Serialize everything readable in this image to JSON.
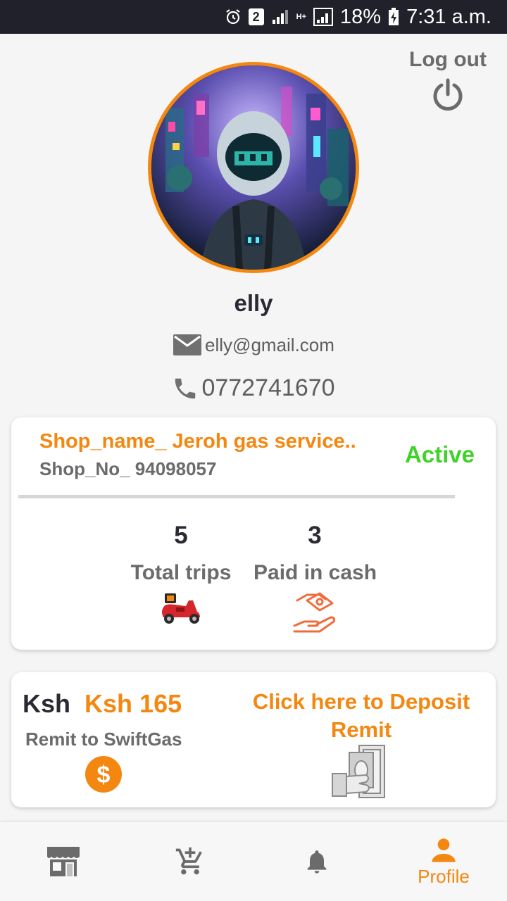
{
  "status_bar": {
    "sim_slot": "2",
    "network_type": "H+",
    "battery": "18%",
    "time": "7:31 a.m."
  },
  "header": {
    "logout_label": "Log out"
  },
  "profile": {
    "name": "elly",
    "email": "elly@gmail.com",
    "phone": "0772741670"
  },
  "shop_card": {
    "shop_name": "Shop_name_ Jeroh gas service..",
    "shop_no": "Shop_No_ 94098057",
    "status": "Active",
    "stats": [
      {
        "value": "5",
        "label": "Total trips",
        "icon": "scooter-icon"
      },
      {
        "value": "3",
        "label": "Paid in cash",
        "icon": "cash-handover-icon"
      }
    ]
  },
  "remit_card": {
    "currency": "Ksh",
    "amount": "Ksh 165",
    "label": "Remit to SwiftGas",
    "deposit_link": "Click here to Deposit Remit"
  },
  "bottom_nav": {
    "items": [
      {
        "icon": "shop-icon",
        "label": ""
      },
      {
        "icon": "add-to-cart-icon",
        "label": ""
      },
      {
        "icon": "bell-icon",
        "label": ""
      },
      {
        "icon": "person-icon",
        "label": "Profile",
        "active": true
      }
    ]
  },
  "colors": {
    "accent": "#f4870f",
    "active_status": "#3ed22a",
    "status_bar": "#20212b",
    "muted_text": "#6b6b6b"
  }
}
